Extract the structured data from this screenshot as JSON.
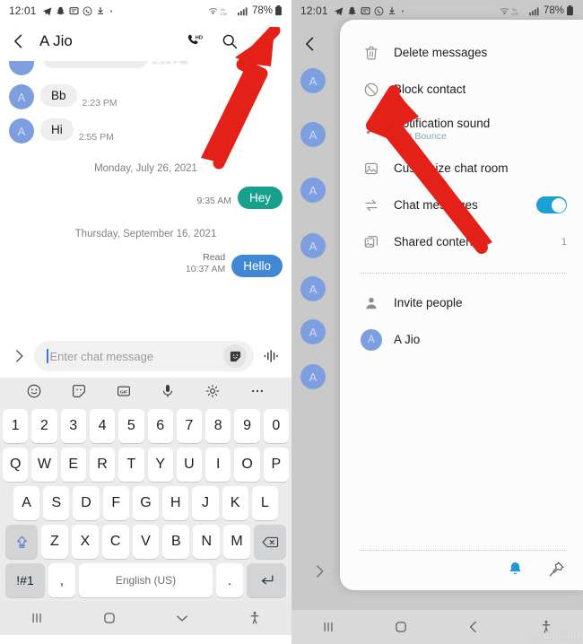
{
  "status_bar": {
    "time": "12:01",
    "battery_percent": "78%",
    "left_icons": [
      "telegram-icon",
      "snapchat-icon",
      "message-icon",
      "whatsapp-icon",
      "download-icon",
      "dot-icon"
    ],
    "right_icons": [
      "wifi-icon",
      "volte-icon",
      "signal-icon",
      "battery-icon"
    ]
  },
  "left_screen": {
    "app_bar": {
      "back": "‹",
      "title": "A Jio",
      "call_icon": "hd-call-icon",
      "search_icon": "search-icon",
      "more_icon": "more-vertical-icon"
    },
    "messages": [
      {
        "type": "incoming",
        "avatar": "A",
        "text": "Bb",
        "time": "2:23 PM"
      },
      {
        "type": "incoming",
        "avatar": "A",
        "text": "Hi",
        "time": "2:55 PM"
      },
      {
        "type": "date",
        "text": "Monday, July 26, 2021"
      },
      {
        "type": "outgoing",
        "text": "Hey",
        "time": "9:35 AM",
        "status": "",
        "color": "#17a08c"
      },
      {
        "type": "date",
        "text": "Thursday, September 16, 2021"
      },
      {
        "type": "outgoing",
        "text": "Hello",
        "time": "10:37 AM",
        "status": "Read",
        "color": "#4287d6"
      }
    ],
    "composer": {
      "expand_icon": "chevron-right-icon",
      "placeholder": "Enter chat message",
      "sticker_icon": "sticker-icon",
      "voice_icon": "voice-wave-icon"
    },
    "keyboard": {
      "toolbar": [
        "emoji-icon",
        "sticker-icon",
        "gif-icon",
        "mic-icon",
        "settings-icon",
        "more-icon"
      ],
      "row_numbers": [
        "1",
        "2",
        "3",
        "4",
        "5",
        "6",
        "7",
        "8",
        "9",
        "0"
      ],
      "row_q": [
        "Q",
        "W",
        "E",
        "R",
        "T",
        "Y",
        "U",
        "I",
        "O",
        "P"
      ],
      "row_a": [
        "A",
        "S",
        "D",
        "F",
        "G",
        "H",
        "J",
        "K",
        "L"
      ],
      "row_z": [
        "Z",
        "X",
        "C",
        "V",
        "B",
        "N",
        "M"
      ],
      "shift_key": "shift-icon",
      "backspace_key": "backspace-icon",
      "symbols_key": "!#1",
      "comma_key": ",",
      "space_key": "English (US)",
      "period_key": ".",
      "enter_key": "enter-icon"
    },
    "nav_bar": [
      "recents-icon",
      "home-icon",
      "keyboard-down-icon",
      "accessibility-icon"
    ]
  },
  "right_screen": {
    "menu_items": [
      {
        "icon": "trash-icon",
        "label": "Delete messages",
        "sub": "",
        "right": "",
        "toggle": false
      },
      {
        "icon": "block-icon",
        "label": "Block contact",
        "sub": "",
        "right": "",
        "toggle": false
      },
      {
        "icon": "note-icon",
        "label": "Notification sound",
        "sub": "8-bit Bounce",
        "right": "",
        "toggle": false
      },
      {
        "icon": "image-icon",
        "label": "Customize chat room",
        "sub": "",
        "right": "",
        "toggle": false
      },
      {
        "icon": "exchange-icon",
        "label": "Chat messages",
        "sub": "",
        "right": "",
        "toggle": true
      },
      {
        "icon": "gallery-icon",
        "label": "Shared content",
        "sub": "",
        "right": "1",
        "toggle": false
      }
    ],
    "people": [
      {
        "icon": "person-icon",
        "label": "Invite people",
        "avatar": ""
      },
      {
        "icon": "",
        "label": "A Jio",
        "avatar": "A"
      }
    ],
    "footer_icons": [
      "bell-icon",
      "pin-icon"
    ],
    "nav_bar": [
      "recents-icon",
      "home-icon",
      "back-icon",
      "accessibility-icon"
    ]
  },
  "annotations": {
    "arrow_color": "#e32119",
    "arrow_left_target": "more-vertical-icon",
    "arrow_right_target": "Block contact"
  },
  "watermark": "wsxdn.com"
}
